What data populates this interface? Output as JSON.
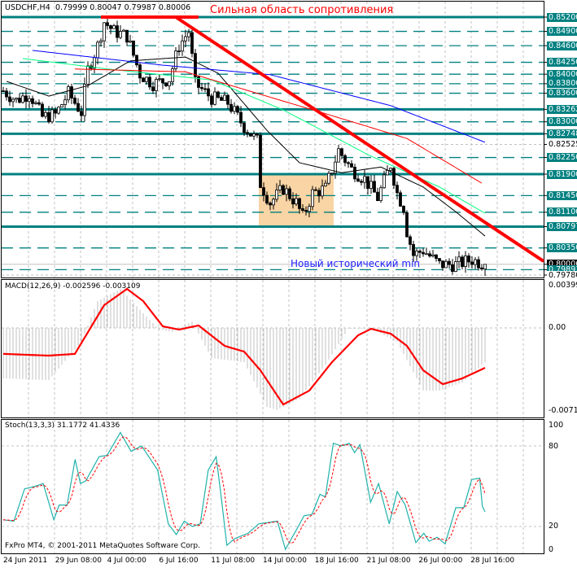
{
  "header": {
    "symbol": "USDCHF,H4",
    "ohlc": "0.79999 0.80047 0.79987 0.80006"
  },
  "annotations": {
    "resistance": "Сильная область сопротивления",
    "new_min": "Новый исторический min"
  },
  "macd": {
    "title": "MACD(12,26,9) -0.002596 -0.003109",
    "axis": [
      "0.00399",
      "0.00",
      "-0.00714"
    ]
  },
  "stoch": {
    "title": "Stoch(13,3,3) 31.1772 41.4336",
    "axis": [
      "100",
      "80",
      "20",
      "0"
    ]
  },
  "copyright": "FxPro MT4, © 2001-2011 MetaQuotes Software Corp.",
  "time_labels": [
    "24 Jun 2011",
    "29 Jun 08:00",
    "4 Jul 00:00",
    "6 Jul 16:00",
    "11 Jul 08:00",
    "14 Jul 00:00",
    "18 Jul 16:00",
    "21 Jul 08:00",
    "26 Jul 00:00",
    "28 Jul 16:00"
  ],
  "colors": {
    "teal": "#008080",
    "trend": "#ff0000",
    "zone": "#f9d4a4",
    "bull": "#ffffff",
    "bear": "#000000",
    "stoch_main": "#20b2aa",
    "stoch_signal": "#ff0000",
    "macd_hist": "#c0c0c0",
    "macd_signal": "#ff0000"
  },
  "chart_data": {
    "type": "candlestick",
    "symbol": "USDCHF",
    "timeframe": "H4",
    "price_range": [
      0.7978,
      0.852
    ],
    "price_levels": [
      {
        "label": "0.85200",
        "style": "solid"
      },
      {
        "label": "0.84900",
        "style": "dash"
      },
      {
        "label": "0.84600",
        "style": "dash"
      },
      {
        "label": "0.84250",
        "style": "dash"
      },
      {
        "label": "0.84000",
        "style": "dash"
      },
      {
        "label": "0.83800",
        "style": "dash"
      },
      {
        "label": "0.83600",
        "style": "dash"
      },
      {
        "label": "0.83262",
        "style": "solid"
      },
      {
        "label": "0.83000",
        "style": "dash"
      },
      {
        "label": "0.82748",
        "style": "solid"
      },
      {
        "label": "0.82525",
        "style": "plain"
      },
      {
        "label": "0.82250",
        "style": "dash"
      },
      {
        "label": "0.81900",
        "style": "solid"
      },
      {
        "label": "0.81450",
        "style": "dash"
      },
      {
        "label": "0.81100",
        "style": "dash"
      },
      {
        "label": "0.80797",
        "style": "solid"
      },
      {
        "label": "0.80350",
        "style": "dash"
      },
      {
        "label": "0.80006",
        "style": "current"
      },
      {
        "label": "0.79893",
        "style": "dash"
      },
      {
        "label": "0.79780",
        "style": "plain"
      }
    ],
    "close_keypoints": [
      [
        0,
        0.8365
      ],
      [
        4,
        0.8345
      ],
      [
        8,
        0.836
      ],
      [
        12,
        0.831
      ],
      [
        16,
        0.8315
      ],
      [
        20,
        0.836
      ],
      [
        24,
        0.832
      ],
      [
        26,
        0.841
      ],
      [
        29,
        0.846
      ],
      [
        31,
        0.851
      ],
      [
        34,
        0.849
      ],
      [
        38,
        0.848
      ],
      [
        42,
        0.84
      ],
      [
        46,
        0.838
      ],
      [
        51,
        0.839
      ],
      [
        54,
        0.846
      ],
      [
        57,
        0.849
      ],
      [
        59,
        0.838
      ],
      [
        64,
        0.835
      ],
      [
        69,
        0.834
      ],
      [
        74,
        0.829
      ],
      [
        78,
        0.826
      ],
      [
        79,
        0.817
      ],
      [
        82,
        0.813
      ],
      [
        86,
        0.816
      ],
      [
        90,
        0.813
      ],
      [
        92,
        0.81
      ],
      [
        95,
        0.815
      ],
      [
        99,
        0.816
      ],
      [
        103,
        0.824
      ],
      [
        107,
        0.82
      ],
      [
        111,
        0.818
      ],
      [
        115,
        0.814
      ],
      [
        119,
        0.821
      ],
      [
        121,
        0.815
      ],
      [
        123,
        0.812
      ],
      [
        124,
        0.807
      ],
      [
        126,
        0.802
      ],
      [
        129,
        0.803
      ],
      [
        134,
        0.8
      ],
      [
        139,
        0.8
      ],
      [
        144,
        0.801
      ],
      [
        148,
        0.80006
      ]
    ],
    "moving_averages": [
      {
        "color": "#000000",
        "points": [
          [
            1,
            0.8385
          ],
          [
            14,
            0.8354
          ],
          [
            26,
            0.8376
          ],
          [
            39,
            0.8428
          ],
          [
            56,
            0.8436
          ],
          [
            66,
            0.8402
          ],
          [
            81,
            0.8282
          ],
          [
            91,
            0.8214
          ],
          [
            104,
            0.8193
          ],
          [
            116,
            0.8205
          ],
          [
            129,
            0.8163
          ],
          [
            139,
            0.8111
          ],
          [
            148,
            0.806
          ]
        ]
      },
      {
        "color": "#00ff80",
        "points": [
          [
            6,
            0.8433
          ],
          [
            32,
            0.8411
          ],
          [
            64,
            0.8388
          ],
          [
            86,
            0.8325
          ],
          [
            112,
            0.8231
          ],
          [
            134,
            0.8163
          ],
          [
            148,
            0.8108
          ]
        ]
      },
      {
        "color": "#ff0000",
        "points": [
          [
            22,
            0.8411
          ],
          [
            56,
            0.8405
          ],
          [
            74,
            0.8368
          ],
          [
            99,
            0.8317
          ],
          [
            124,
            0.8265
          ],
          [
            147,
            0.8171
          ]
        ]
      },
      {
        "color": "#0000ff",
        "points": [
          [
            9,
            0.845
          ],
          [
            49,
            0.8419
          ],
          [
            82,
            0.8399
          ],
          [
            119,
            0.8334
          ],
          [
            148,
            0.8257
          ]
        ]
      }
    ],
    "trendline": {
      "from": [
        53,
        0.852
      ],
      "to": [
        166,
        0.8007
      ]
    },
    "resistance_zone": {
      "from_bar": 30,
      "to_bar": 60,
      "price": 0.852
    },
    "range_box": {
      "from_bar": 79,
      "to_bar": 101,
      "high": 0.819,
      "low": 0.80797
    },
    "macd_range": [
      -0.00714,
      0.00399
    ],
    "macd_hist_keypoints": [
      [
        0,
        -0.00467
      ],
      [
        14,
        -0.00482
      ],
      [
        24,
        -0.00128
      ],
      [
        29,
        0.00248
      ],
      [
        36,
        0.00361
      ],
      [
        43,
        0.00136
      ],
      [
        48,
        -0.00015
      ],
      [
        52,
        -0.00038
      ],
      [
        58,
        0.0006
      ],
      [
        64,
        -0.00279
      ],
      [
        74,
        -0.00316
      ],
      [
        81,
        -0.0073
      ],
      [
        84,
        -0.0076
      ],
      [
        91,
        -0.00655
      ],
      [
        99,
        -0.00339
      ],
      [
        106,
        -8e-05
      ],
      [
        113,
        -8e-05
      ],
      [
        121,
        -0.00128
      ],
      [
        129,
        -0.0058
      ],
      [
        134,
        -0.0058
      ],
      [
        141,
        -0.00505
      ],
      [
        148,
        -0.00316
      ]
    ],
    "macd_signal_keypoints": [
      [
        0,
        -0.0024
      ],
      [
        14,
        -0.00256
      ],
      [
        22,
        -0.0024
      ],
      [
        31,
        0.00211
      ],
      [
        38,
        0.00361
      ],
      [
        43,
        0.00248
      ],
      [
        49,
        0.00015
      ],
      [
        54,
        -0.00015
      ],
      [
        60,
        0.00023
      ],
      [
        68,
        -0.00166
      ],
      [
        74,
        -0.00219
      ],
      [
        79,
        -0.00392
      ],
      [
        86,
        -0.00708
      ],
      [
        94,
        -0.0058
      ],
      [
        101,
        -0.00316
      ],
      [
        109,
        -0.00068
      ],
      [
        113,
        -8e-05
      ],
      [
        119,
        -0.00053
      ],
      [
        124,
        -0.00166
      ],
      [
        129,
        -0.00392
      ],
      [
        135,
        -0.0052
      ],
      [
        141,
        -0.00467
      ],
      [
        148,
        -0.00369
      ]
    ],
    "stoch_range": [
      0,
      100
    ],
    "stoch_levels": [
      80,
      20
    ],
    "stoch_main_keypoints": [
      [
        0,
        25
      ],
      [
        4,
        24
      ],
      [
        8,
        48
      ],
      [
        12,
        50
      ],
      [
        15,
        52
      ],
      [
        19,
        25
      ],
      [
        21,
        36
      ],
      [
        24,
        36
      ],
      [
        27,
        70
      ],
      [
        29,
        52
      ],
      [
        31,
        54
      ],
      [
        36,
        72
      ],
      [
        39,
        73
      ],
      [
        44,
        90
      ],
      [
        48,
        76
      ],
      [
        52,
        80
      ],
      [
        56,
        68
      ],
      [
        58,
        62
      ],
      [
        62,
        22
      ],
      [
        65,
        14
      ],
      [
        68,
        24
      ],
      [
        71,
        20
      ],
      [
        74,
        22
      ],
      [
        77,
        62
      ],
      [
        80,
        72
      ],
      [
        82,
        40
      ],
      [
        84,
        6
      ],
      [
        87,
        11
      ],
      [
        92,
        15
      ],
      [
        96,
        22
      ],
      [
        103,
        24
      ],
      [
        106,
        3
      ],
      [
        110,
        17
      ],
      [
        113,
        28
      ],
      [
        116,
        29
      ],
      [
        119,
        44
      ],
      [
        121,
        42
      ],
      [
        124,
        82
      ],
      [
        127,
        80
      ],
      [
        130,
        82
      ],
      [
        132,
        75
      ],
      [
        134,
        81
      ],
      [
        138,
        38
      ],
      [
        141,
        52
      ],
      [
        145,
        22
      ],
      [
        148,
        46
      ],
      [
        151,
        36
      ],
      [
        155,
        8
      ],
      [
        158,
        15
      ],
      [
        160,
        9
      ],
      [
        163,
        12
      ],
      [
        166,
        7
      ],
      [
        170,
        34
      ],
      [
        173,
        34
      ],
      [
        176,
        55
      ],
      [
        179,
        56
      ],
      [
        180,
        35
      ],
      [
        181,
        31
      ]
    ]
  }
}
